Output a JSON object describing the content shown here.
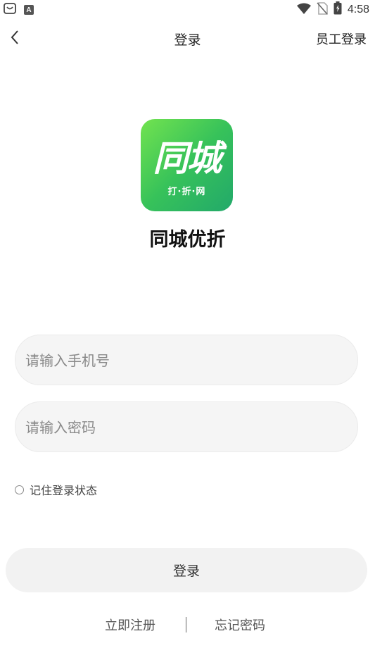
{
  "status_bar": {
    "time": "4:58",
    "badge_letter": "A",
    "icons": [
      "shop-bag-icon",
      "a-badge-icon",
      "wifi-icon",
      "no-sim-icon",
      "battery-icon"
    ]
  },
  "nav": {
    "title": "登录",
    "staff_login": "员工登录",
    "back_icon": "chevron-left-icon"
  },
  "logo": {
    "main_text": "同城",
    "sub_text": "打·折·网",
    "gradient_colors": [
      "#72e34f",
      "#37c25a",
      "#22a96a"
    ]
  },
  "app_name": "同城优折",
  "form": {
    "phone_placeholder": "请输入手机号",
    "phone_value": "",
    "password_placeholder": "请输入密码",
    "password_value": "",
    "remember_label": "记住登录状态",
    "remember_checked": false
  },
  "login_button": "登录",
  "footer": {
    "register": "立即注册",
    "forgot_password": "忘记密码"
  }
}
